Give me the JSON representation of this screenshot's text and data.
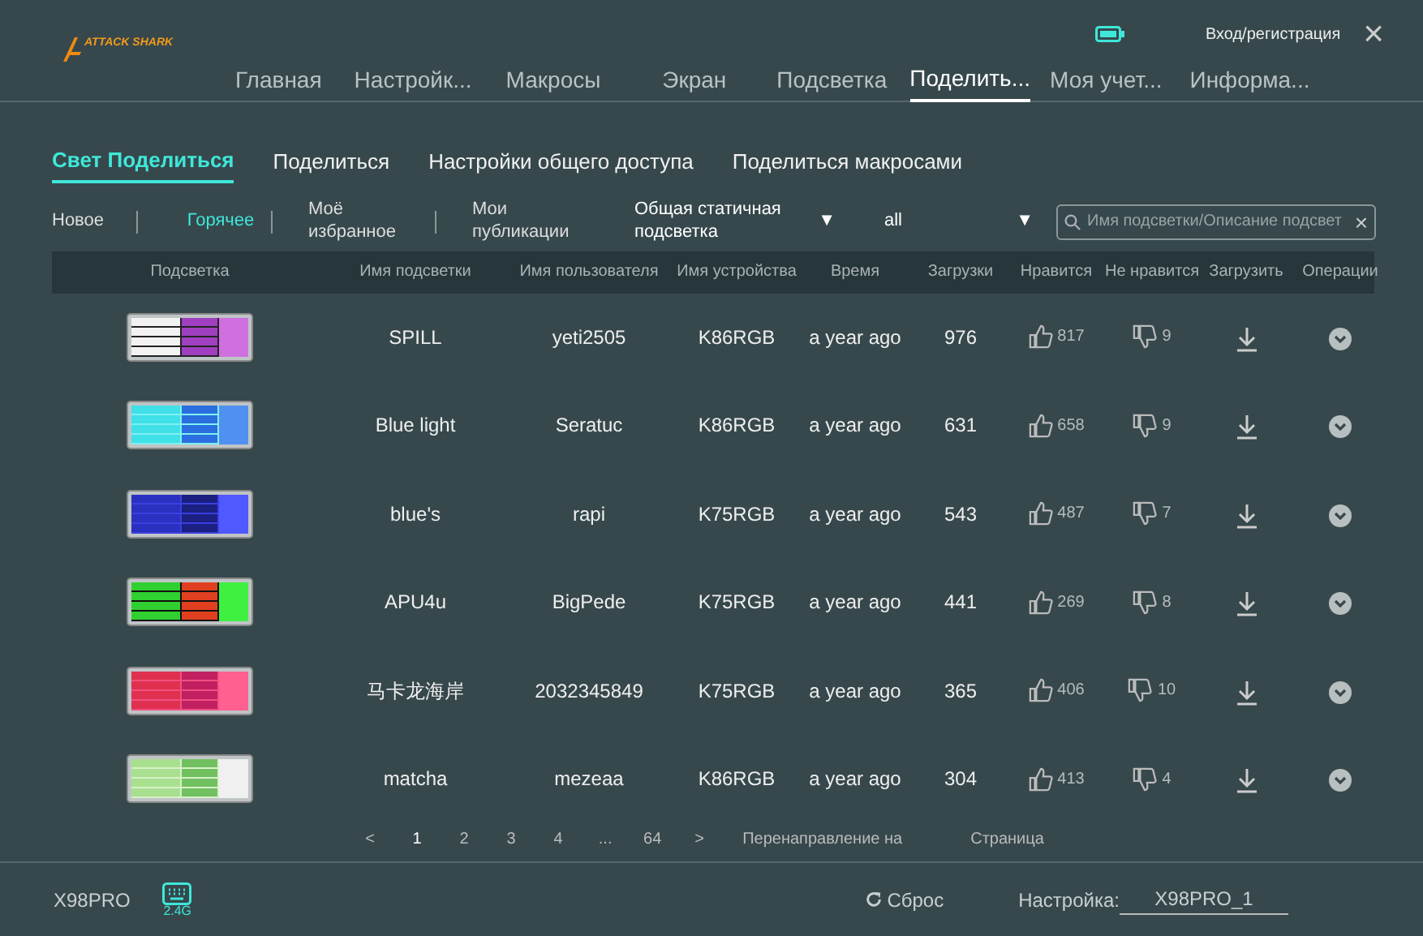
{
  "logo": {
    "text": "ATTACK SHARK"
  },
  "header": {
    "login": "Вход/регистрация",
    "close": "×"
  },
  "nav": [
    {
      "label": "Главная",
      "selected": false
    },
    {
      "label": "Настройк...",
      "selected": false
    },
    {
      "label": "Макросы",
      "selected": false
    },
    {
      "label": "Экран",
      "selected": false
    },
    {
      "label": "Подсветка",
      "selected": false
    },
    {
      "label": "Поделить...",
      "selected": true
    },
    {
      "label": "Моя учет...",
      "selected": false
    },
    {
      "label": "Информа...",
      "selected": false
    }
  ],
  "subtabs": [
    {
      "label": "Свет Поделиться",
      "selected": true
    },
    {
      "label": "Поделиться",
      "selected": false
    },
    {
      "label": "Настройки общего доступа",
      "selected": false
    },
    {
      "label": "Поделиться макросами",
      "selected": false
    }
  ],
  "filters": [
    {
      "label": "Новое",
      "selected": false
    },
    {
      "label": "Горячее",
      "selected": true
    },
    {
      "label": "Моё избранное",
      "selected": false
    },
    {
      "label": "Мои публикации",
      "selected": false
    }
  ],
  "dropdowns": [
    {
      "value": "Общая статичная подсветка",
      "caret": "▼"
    },
    {
      "value": "all",
      "caret": "▼"
    }
  ],
  "search": {
    "placeholder": "Имя подсветки/Описание подсвет",
    "clear": "×"
  },
  "table": {
    "columns": [
      "Подсветка",
      "Имя подсветки",
      "Имя пользователя",
      "Имя устройства",
      "Время",
      "Загрузки",
      "Нравится",
      "Не нравится",
      "Загрузить",
      "Операции"
    ],
    "rows": [
      {
        "name": "SPILL",
        "user": "yeti2505",
        "device": "K86RGB",
        "time": "a year ago",
        "downloads": "976",
        "likes": "817",
        "dislikes": "9"
      },
      {
        "name": "Blue light",
        "user": "Seratuc",
        "device": "K86RGB",
        "time": "a year ago",
        "downloads": "631",
        "likes": "658",
        "dislikes": "9"
      },
      {
        "name": "blue's",
        "user": "rapi",
        "device": "K75RGB",
        "time": "a year ago",
        "downloads": "543",
        "likes": "487",
        "dislikes": "7"
      },
      {
        "name": "APU4u",
        "user": "BigPede",
        "device": "K75RGB",
        "time": "a year ago",
        "downloads": "441",
        "likes": "269",
        "dislikes": "8"
      },
      {
        "name": "马卡龙海岸",
        "user": "2032345849",
        "device": "K75RGB",
        "time": "a year ago",
        "downloads": "365",
        "likes": "406",
        "dislikes": "10"
      },
      {
        "name": "matcha",
        "user": "mezeaa",
        "device": "K86RGB",
        "time": "a year ago",
        "downloads": "304",
        "likes": "413",
        "dislikes": "4"
      }
    ]
  },
  "pagination": {
    "prev": "<",
    "pages": [
      {
        "label": "1",
        "selected": true
      },
      {
        "label": "2",
        "selected": false
      },
      {
        "label": "3",
        "selected": false
      },
      {
        "label": "4",
        "selected": false
      },
      {
        "label": "...",
        "selected": false
      },
      {
        "label": "64",
        "selected": false
      }
    ],
    "next": ">",
    "goto": "Перенаправление на",
    "page_label": "Страница"
  },
  "footer": {
    "device": "X98PRO",
    "connection": "2.4G",
    "reset": "Сброс",
    "profile_label": "Настройка:",
    "profile": "X98PRO_1"
  }
}
